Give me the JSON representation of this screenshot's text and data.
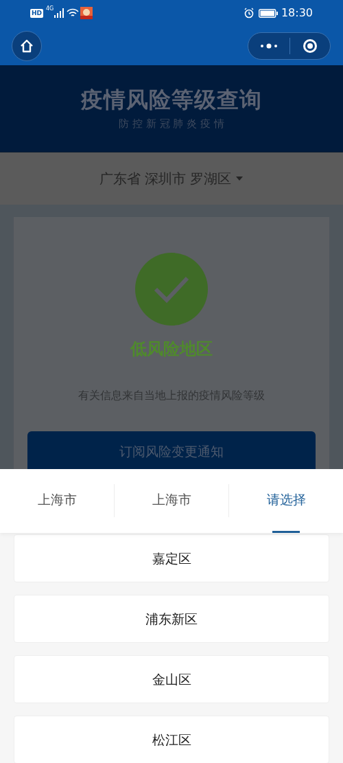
{
  "status_bar": {
    "hd": "HD",
    "network": "4G",
    "time": "18:30"
  },
  "header": {
    "title": "疫情风险等级查询",
    "subtitle": "防 控 新 冠 肺 炎 疫 情"
  },
  "location": {
    "text": "广东省 深圳市 罗湖区"
  },
  "result": {
    "risk": "低风险地区",
    "note": "有关信息来自当地上报的疫情风险等级",
    "subscribe": "订阅风险变更通知"
  },
  "picker": {
    "tabs": [
      {
        "label": "上海市",
        "selected": false
      },
      {
        "label": "上海市",
        "selected": false
      },
      {
        "label": "请选择",
        "selected": true
      }
    ],
    "items": [
      "嘉定区",
      "浦东新区",
      "金山区",
      "松江区"
    ]
  }
}
